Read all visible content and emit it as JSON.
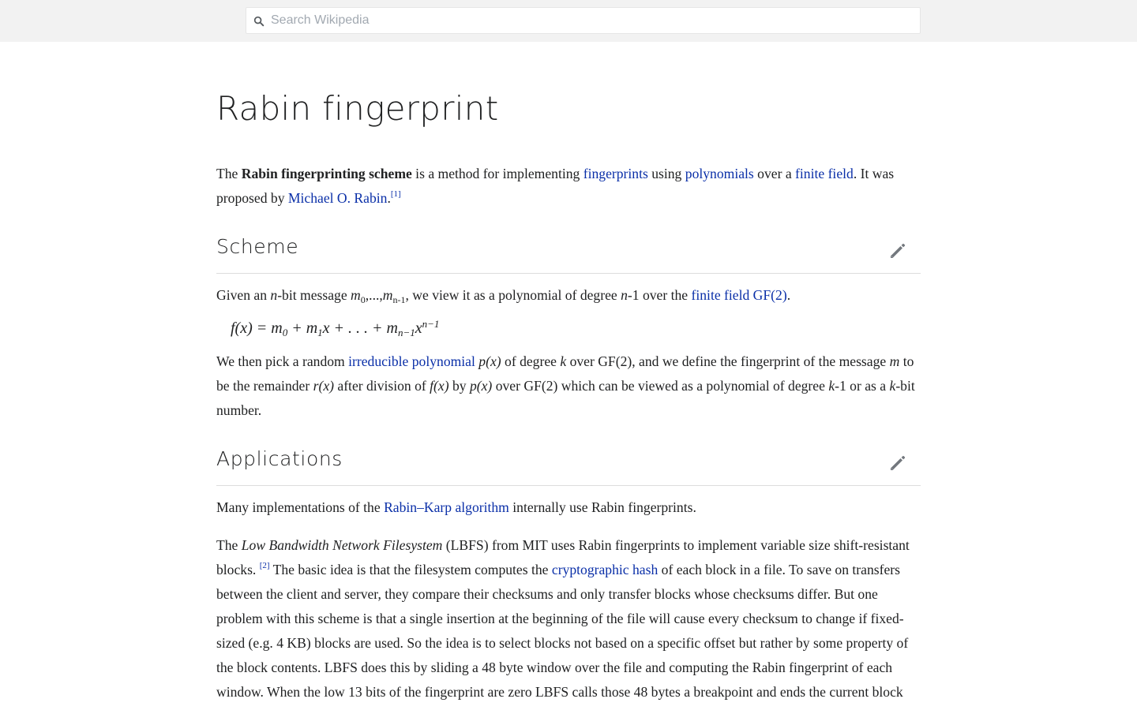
{
  "search": {
    "placeholder": "Search Wikipedia"
  },
  "article": {
    "title": "Rabin fingerprint"
  },
  "intro": {
    "t1": "The ",
    "b1": "Rabin fingerprinting scheme",
    "t2": " is a method for implementing ",
    "link_fingerprints": "fingerprints",
    "t3": " using ",
    "link_polynomials": "polynomials",
    "t4": " over a ",
    "link_finite_field": "finite field",
    "t5": ". It was proposed by ",
    "link_rabin": "Michael O. Rabin",
    "t6": ".",
    "ref1": "[1]"
  },
  "sections": [
    {
      "title": "Scheme"
    },
    {
      "title": "Applications"
    }
  ],
  "scheme": {
    "p1_a": "Given an ",
    "p1_n": "n",
    "p1_b": "-bit message ",
    "p1_m0": "m",
    "p1_m0sub": "0",
    "p1_dots": ",...,",
    "p1_mn": "m",
    "p1_mnsub": "n-1",
    "p1_c": ", we view it as a polynomial of degree ",
    "p1_deg": "n",
    "p1_d": "-1 over the ",
    "p1_link": "finite field GF(2)",
    "p1_e": ".",
    "formula": {
      "lhs": "f(x) = m",
      "sub0": "0",
      "mid1": " + m",
      "sub1": "1",
      "mid2": "x + . . . + m",
      "subn": "n−1",
      "x": "x",
      "exp": "n−1"
    },
    "p2_a": "We then pick a random ",
    "p2_link": "irreducible polynomial",
    "p2_px": " p(x) ",
    "p2_b": " of degree ",
    "p2_k": "k",
    "p2_c": " over GF(2), and we define the fingerprint of the message ",
    "p2_m": "m",
    "p2_d": " to be the remainder ",
    "p2_rx": "r(x)",
    "p2_e": " after division of ",
    "p2_fx": "f(x)",
    "p2_f": " by ",
    "p2_px2": "p(x)",
    "p2_g": " over GF(2) which can be viewed as a polynomial of degree ",
    "p2_k2": "k",
    "p2_h": "-1 or as a ",
    "p2_k3": "k",
    "p2_i": "-bit number."
  },
  "applications": {
    "p1_a": "Many implementations of the ",
    "p1_link": "Rabin–Karp algorithm",
    "p1_b": " internally use Rabin fingerprints.",
    "p2_a": "The ",
    "p2_i": "Low Bandwidth Network Filesystem",
    "p2_b": " (LBFS) from MIT uses Rabin fingerprints to implement variable size shift-resistant blocks. ",
    "ref2": "[2]",
    "p2_c": " The basic idea is that the filesystem computes the ",
    "p2_link": "cryptographic hash",
    "p2_d": " of each block in a file. To save on transfers between the client and server, they compare their checksums and only transfer blocks whose checksums differ. But one problem with this scheme is that a single insertion at the beginning of the file will cause every checksum to change if fixed-sized (e.g. 4 KB) blocks are used. So the idea is to select blocks not based on a specific offset but rather by some property of the block contents. LBFS does this by sliding a 48 byte window over the file and computing the Rabin fingerprint of each window. When the low 13 bits of the fingerprint are zero LBFS calls those 48 bytes a breakpoint and ends the current block"
  },
  "icons": {
    "search": "search-icon",
    "edit": "pencil-icon"
  },
  "colors": {
    "link": "#0a2fa8",
    "topbar": "#f2f2f2",
    "text": "#202122"
  }
}
